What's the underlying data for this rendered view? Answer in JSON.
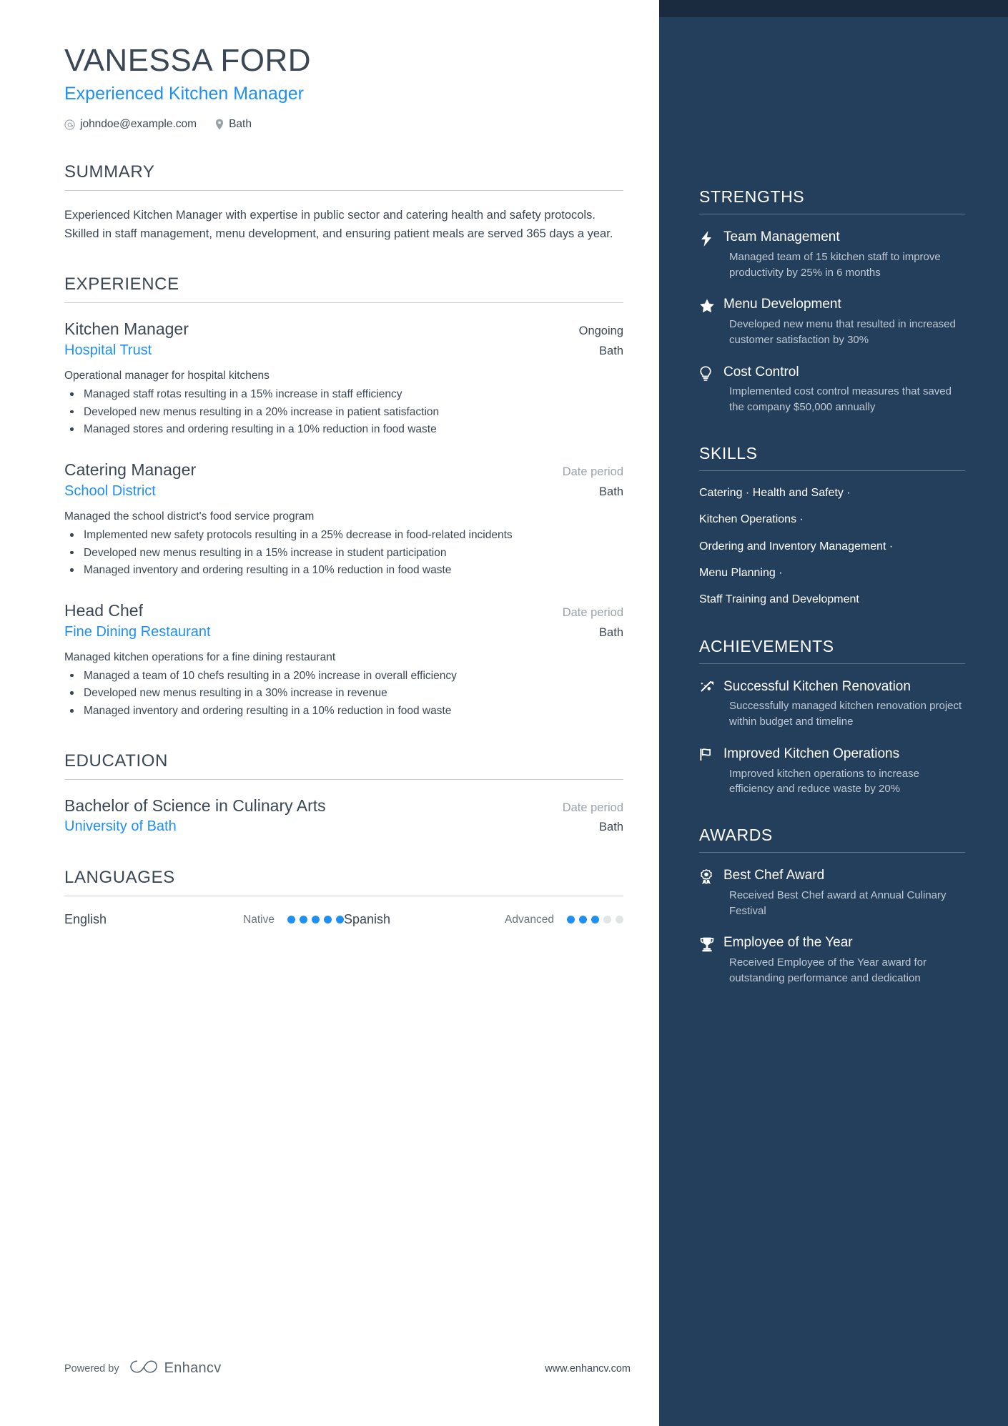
{
  "colors": {
    "accent_blue": "#1E90F5",
    "sidebar_bg": "#243F5C",
    "sidebar_top_strip": "#1A2B40",
    "text_dark": "#3B4754",
    "muted": "#9AA3AC",
    "sidebar_desc": "#BFC9D3",
    "dot_empty": "#E2E5E8"
  },
  "header": {
    "name": "VANESSA FORD",
    "job_title": "Experienced Kitchen Manager",
    "contacts": [
      {
        "icon": "email-icon",
        "value": "johndoe@example.com"
      },
      {
        "icon": "location-pin-icon",
        "value": "Bath"
      }
    ]
  },
  "summary": {
    "heading": "SUMMARY",
    "text": "Experienced Kitchen Manager with expertise in public sector and catering health and safety protocols. Skilled in staff management, menu development, and ensuring patient meals are served 365 days a year."
  },
  "experience": {
    "heading": "EXPERIENCE",
    "entries": [
      {
        "title": "Kitchen Manager",
        "date": "Ongoing",
        "date_is_placeholder": false,
        "organization": "Hospital Trust",
        "location": "Bath",
        "description": "Operational manager for hospital kitchens",
        "bullets": [
          "Managed staff rotas resulting in a 15% increase in staff efficiency",
          "Developed new menus resulting in a 20% increase in patient satisfaction",
          "Managed stores and ordering resulting in a 10% reduction in food waste"
        ]
      },
      {
        "title": "Catering Manager",
        "date": "Date period",
        "date_is_placeholder": true,
        "organization": "School District",
        "location": "Bath",
        "description": "Managed the school district's food service program",
        "bullets": [
          "Implemented new safety protocols resulting in a 25% decrease in food-related incidents",
          "Developed new menus resulting in a 15% increase in student participation",
          "Managed inventory and ordering resulting in a 10% reduction in food waste"
        ]
      },
      {
        "title": "Head Chef",
        "date": "Date period",
        "date_is_placeholder": true,
        "organization": "Fine Dining Restaurant",
        "location": "Bath",
        "description": "Managed kitchen operations for a fine dining restaurant",
        "bullets": [
          "Managed a team of 10 chefs resulting in a 20% increase in overall efficiency",
          "Developed new menus resulting in a 30% increase in revenue",
          "Managed inventory and ordering resulting in a 10% reduction in food waste"
        ]
      }
    ]
  },
  "education": {
    "heading": "EDUCATION",
    "entries": [
      {
        "degree": "Bachelor of Science in Culinary Arts",
        "date": "Date period",
        "institution": "University of Bath",
        "location": "Bath"
      }
    ]
  },
  "languages": {
    "heading": "LANGUAGES",
    "items": [
      {
        "name": "English",
        "level": "Native",
        "filled": 5,
        "total": 5
      },
      {
        "name": "Spanish",
        "level": "Advanced",
        "filled": 3,
        "total": 5
      }
    ]
  },
  "strengths": {
    "heading": "STRENGTHS",
    "items": [
      {
        "icon": "lightning-bolt-icon",
        "title": "Team Management",
        "description": "Managed team of 15 kitchen staff to improve productivity by 25% in 6 months"
      },
      {
        "icon": "star-icon",
        "title": "Menu Development",
        "description": "Developed new menu that resulted in increased customer satisfaction by 30%"
      },
      {
        "icon": "lightbulb-icon",
        "title": "Cost Control",
        "description": "Implemented cost control measures that saved the company $50,000 annually"
      }
    ]
  },
  "skills": {
    "heading": "SKILLS",
    "lines": [
      "Catering · Health and Safety ·",
      "Kitchen Operations ·",
      "Ordering and Inventory Management ·",
      "Menu Planning ·",
      "Staff Training and Development"
    ]
  },
  "achievements": {
    "heading": "ACHIEVEMENTS",
    "items": [
      {
        "icon": "rocket-trend-icon",
        "title": "Successful Kitchen Renovation",
        "description": "Successfully managed kitchen renovation project within budget and timeline"
      },
      {
        "icon": "flag-icon",
        "title": "Improved Kitchen Operations",
        "description": "Improved kitchen operations to increase efficiency and reduce waste by 20%"
      }
    ]
  },
  "awards": {
    "heading": "AWARDS",
    "items": [
      {
        "icon": "medal-ribbon-icon",
        "title": "Best Chef Award",
        "description": "Received Best Chef award at Annual Culinary Festival"
      },
      {
        "icon": "trophy-icon",
        "title": "Employee of the Year",
        "description": "Received Employee of the Year award for outstanding performance and dedication"
      }
    ]
  },
  "footer": {
    "powered_by": "Powered by",
    "brand": "Enhancv",
    "url": "www.enhancv.com"
  }
}
